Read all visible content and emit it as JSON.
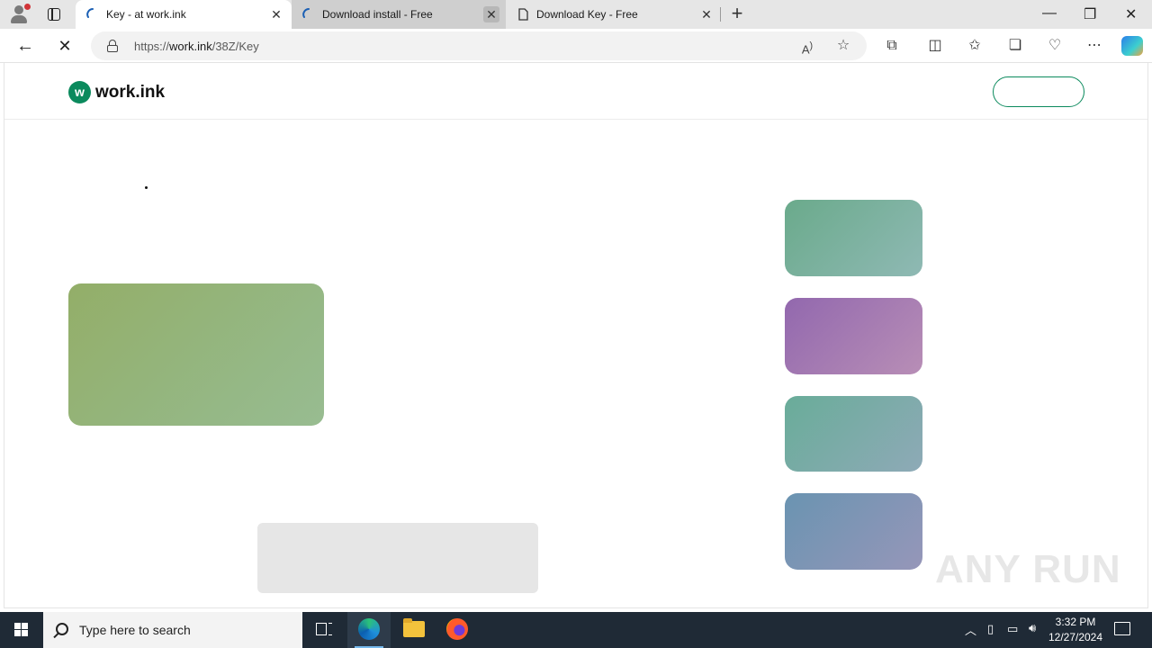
{
  "browser": {
    "tabs": [
      {
        "title": "Key - at work.ink",
        "active": true
      },
      {
        "title": "Download install - Free",
        "active": false
      },
      {
        "title": "Download Key - Free",
        "active": false
      }
    ],
    "url_prefix": "https://",
    "url_host": "work.ink",
    "url_path": "/38Z/Key"
  },
  "site": {
    "logo_mark": "w",
    "logo_name": "work.ink"
  },
  "colors": {
    "brand": "#0b8a5d",
    "card_main": "#93ae68",
    "card_side1": "#6aaa8b",
    "card_side2": "#9268ae",
    "card_side3": "#69ac99",
    "card_side4": "#6a94b1"
  },
  "watermark": "ANY RUN",
  "taskbar": {
    "search_placeholder": "Type here to search",
    "time": "3:32 PM",
    "date": "12/27/2024"
  }
}
